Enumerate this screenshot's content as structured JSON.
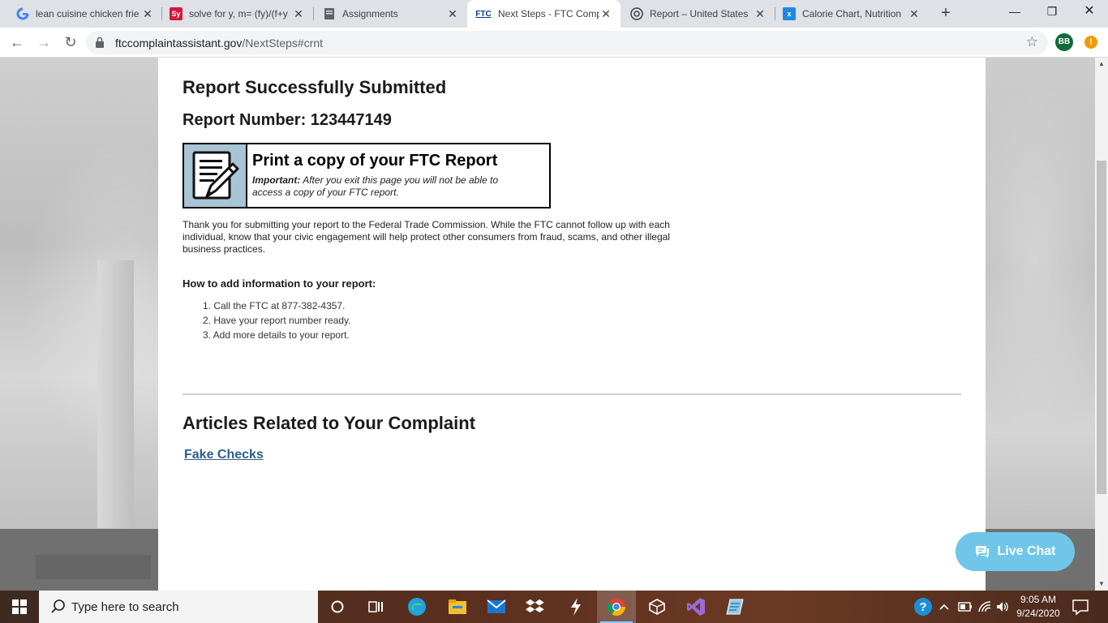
{
  "browser": {
    "tabs": [
      {
        "title": "lean cuisine chicken frie",
        "favicon": "google-icon"
      },
      {
        "title": "solve for y, m= (fy)/(f+y",
        "favicon": "symbolab-icon",
        "badge": "Sy"
      },
      {
        "title": "Assignments",
        "favicon": "document-icon"
      },
      {
        "title": "Next Steps - FTC Compl",
        "favicon": "ftc-icon",
        "badge": "FTC",
        "active": true
      },
      {
        "title": "Report – United States",
        "favicon": "seal-icon"
      },
      {
        "title": "Calorie Chart, Nutrition",
        "favicon": "calorie-icon"
      }
    ],
    "url_domain": "ftccomplaintassistant.gov",
    "url_path": "/NextSteps#crnt",
    "profile_initials": "BB",
    "alert_symbol": "!"
  },
  "page": {
    "heading": "Report Successfully Submitted",
    "report_number": "Report Number: 123447149",
    "print_box": {
      "title": "Print a copy of your FTC Report",
      "important_label": "Important:",
      "important_text": "After you exit this page you will not be able to access a copy of your FTC report."
    },
    "thanks_text": "Thank you for submitting your report to the Federal Trade Commission. While the FTC cannot follow up with each individual, know that your civic engagement will help protect other consumers from fraud, scams, and other illegal business practices.",
    "howto_heading": "How to add information to your report:",
    "steps": [
      "1. Call the FTC at 877-382-4357.",
      "2. Have your report number ready.",
      "3. Add more details to your report."
    ],
    "articles_heading": "Articles Related to Your Complaint",
    "article_link": "Fake Checks",
    "live_chat": "Live Chat"
  },
  "taskbar": {
    "search_placeholder": "Type here to search",
    "time": "9:05 AM",
    "date": "9/24/2020"
  },
  "colors": {
    "link": "#2e5e8c",
    "live_chat": "#6fc6e8",
    "print_icon_bg": "#a9c4d4"
  }
}
